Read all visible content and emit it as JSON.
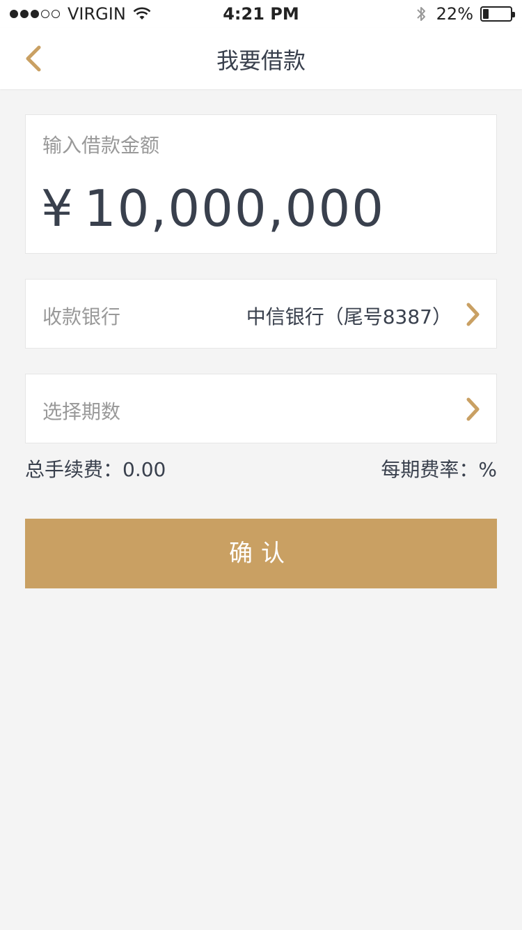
{
  "status_bar": {
    "carrier": "VIRGIN",
    "time": "4:21 PM",
    "battery_percent": "22%",
    "battery_level": 0.22,
    "signal_bars_filled": 3,
    "signal_bars_total": 5
  },
  "header": {
    "title": "我要借款",
    "back_icon": "chevron-left-icon"
  },
  "amount": {
    "label": "输入借款金额",
    "currency": "¥",
    "value": "10,000,000"
  },
  "bank": {
    "label": "收款银行",
    "value": "中信银行（尾号8387）"
  },
  "period": {
    "label": "选择期数"
  },
  "fees": {
    "total_fee_label": "总手续费：",
    "total_fee_value": "0.00",
    "rate_label": "每期费率：",
    "rate_value": "%"
  },
  "confirm": {
    "label": "确认"
  },
  "colors": {
    "accent": "#C9A063",
    "text_primary": "#39404D",
    "text_placeholder": "#999999",
    "background": "#F4F4F4"
  }
}
